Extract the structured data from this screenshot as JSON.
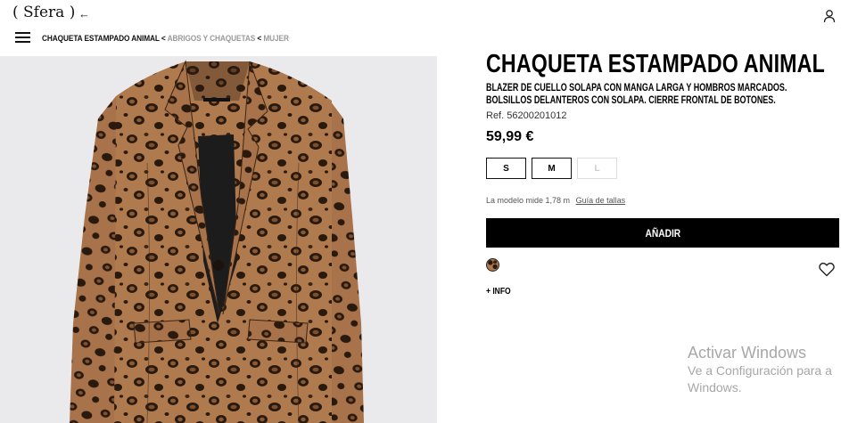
{
  "header": {
    "logo": "( Sfera )",
    "breadcrumb": {
      "current": "CHAQUETA ESTAMPADO ANIMAL",
      "separator": "<",
      "items": [
        "ABRIGOS Y CHAQUETAS",
        "MUJER"
      ]
    }
  },
  "product": {
    "title": "CHAQUETA ESTAMPADO ANIMAL",
    "description": "BLAZER DE CUELLO SOLAPA CON MANGA LARGA Y HOMBROS MARCADOS. BOLSILLOS DELANTEROS CON SOLAPA. CIERRE FRONTAL DE BOTONES.",
    "ref": "Ref. 56200201012",
    "price": "59,99 €",
    "sizes": [
      {
        "label": "S",
        "available": true
      },
      {
        "label": "M",
        "available": true
      },
      {
        "label": "L",
        "available": false
      }
    ],
    "model_info": "La modelo mide 1,78 m",
    "size_guide": "Guía de tallas",
    "add_button": "AÑADIR",
    "more_info": "+ INFO"
  },
  "watermark": {
    "title": "Activar Windows",
    "line1": "Ve a Configuración para a",
    "line2": "Windows."
  },
  "colors": {
    "accent": "#000000",
    "leopard_base": "#b07a4f",
    "leopard_spot": "#2a1a0e",
    "image_bg": "#eaeaec"
  },
  "icons": [
    "back-arrow-icon",
    "user-icon",
    "menu-icon",
    "heart-icon",
    "leopard-swatch"
  ]
}
